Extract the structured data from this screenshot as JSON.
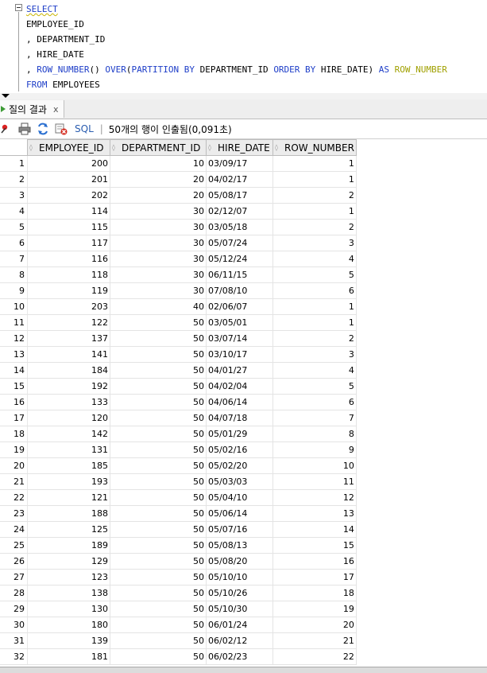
{
  "editor": {
    "lines": [
      {
        "parts": [
          {
            "t": "SELECT",
            "c": "kw sq"
          }
        ]
      },
      {
        "parts": [
          {
            "t": "EMPLOYEE_ID",
            "c": ""
          }
        ]
      },
      {
        "parts": [
          {
            "t": ", DEPARTMENT_ID",
            "c": ""
          }
        ]
      },
      {
        "parts": [
          {
            "t": ", HIRE_DATE",
            "c": ""
          }
        ]
      },
      {
        "parts": [
          {
            "t": ", ",
            "c": ""
          },
          {
            "t": "ROW_NUMBER",
            "c": "fn"
          },
          {
            "t": "() ",
            "c": ""
          },
          {
            "t": "OVER",
            "c": "kw"
          },
          {
            "t": "(",
            "c": ""
          },
          {
            "t": "PARTITION BY",
            "c": "kw"
          },
          {
            "t": " DEPARTMENT_ID ",
            "c": ""
          },
          {
            "t": "ORDER BY",
            "c": "kw"
          },
          {
            "t": " HIRE_DATE) ",
            "c": ""
          },
          {
            "t": "AS",
            "c": "kw"
          },
          {
            "t": " ",
            "c": ""
          },
          {
            "t": "ROW_NUMBER",
            "c": "alias"
          }
        ]
      },
      {
        "parts": [
          {
            "t": "FROM",
            "c": "kw"
          },
          {
            "t": " EMPLOYEES",
            "c": ""
          }
        ]
      }
    ]
  },
  "tab": {
    "label": "질의 결과",
    "close": "x"
  },
  "toolbar": {
    "icons": [
      "pin-icon",
      "print-icon",
      "refresh-icon",
      "clear-icon"
    ],
    "sql_label": "SQL",
    "separator": "|",
    "status": "50개의 행이 인출됨(0,091초)"
  },
  "grid": {
    "columns": [
      "EMPLOYEE_ID",
      "DEPARTMENT_ID",
      "HIRE_DATE",
      "ROW_NUMBER"
    ],
    "rows": [
      [
        "1",
        "200",
        "10",
        "03/09/17",
        "1"
      ],
      [
        "2",
        "201",
        "20",
        "04/02/17",
        "1"
      ],
      [
        "3",
        "202",
        "20",
        "05/08/17",
        "2"
      ],
      [
        "4",
        "114",
        "30",
        "02/12/07",
        "1"
      ],
      [
        "5",
        "115",
        "30",
        "03/05/18",
        "2"
      ],
      [
        "6",
        "117",
        "30",
        "05/07/24",
        "3"
      ],
      [
        "7",
        "116",
        "30",
        "05/12/24",
        "4"
      ],
      [
        "8",
        "118",
        "30",
        "06/11/15",
        "5"
      ],
      [
        "9",
        "119",
        "30",
        "07/08/10",
        "6"
      ],
      [
        "10",
        "203",
        "40",
        "02/06/07",
        "1"
      ],
      [
        "11",
        "122",
        "50",
        "03/05/01",
        "1"
      ],
      [
        "12",
        "137",
        "50",
        "03/07/14",
        "2"
      ],
      [
        "13",
        "141",
        "50",
        "03/10/17",
        "3"
      ],
      [
        "14",
        "184",
        "50",
        "04/01/27",
        "4"
      ],
      [
        "15",
        "192",
        "50",
        "04/02/04",
        "5"
      ],
      [
        "16",
        "133",
        "50",
        "04/06/14",
        "6"
      ],
      [
        "17",
        "120",
        "50",
        "04/07/18",
        "7"
      ],
      [
        "18",
        "142",
        "50",
        "05/01/29",
        "8"
      ],
      [
        "19",
        "131",
        "50",
        "05/02/16",
        "9"
      ],
      [
        "20",
        "185",
        "50",
        "05/02/20",
        "10"
      ],
      [
        "21",
        "193",
        "50",
        "05/03/03",
        "11"
      ],
      [
        "22",
        "121",
        "50",
        "05/04/10",
        "12"
      ],
      [
        "23",
        "188",
        "50",
        "05/06/14",
        "13"
      ],
      [
        "24",
        "125",
        "50",
        "05/07/16",
        "14"
      ],
      [
        "25",
        "189",
        "50",
        "05/08/13",
        "15"
      ],
      [
        "26",
        "129",
        "50",
        "05/08/20",
        "16"
      ],
      [
        "27",
        "123",
        "50",
        "05/10/10",
        "17"
      ],
      [
        "28",
        "138",
        "50",
        "05/10/26",
        "18"
      ],
      [
        "29",
        "130",
        "50",
        "05/10/30",
        "19"
      ],
      [
        "30",
        "180",
        "50",
        "06/01/24",
        "20"
      ],
      [
        "31",
        "139",
        "50",
        "06/02/12",
        "21"
      ],
      [
        "32",
        "181",
        "50",
        "06/02/23",
        "22"
      ]
    ]
  }
}
